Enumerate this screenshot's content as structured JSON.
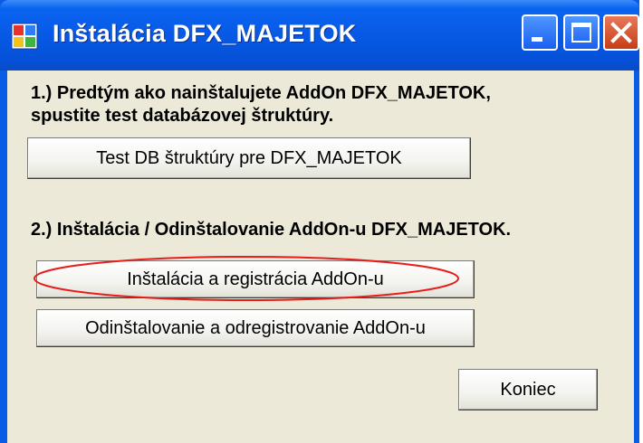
{
  "window": {
    "title": "Inštalácia DFX_MAJETOK",
    "controls": {
      "minimize": "minimize-icon",
      "maximize": "maximize-icon",
      "close": "close-icon"
    }
  },
  "section1": {
    "line1": "1.) Predtým ako nainštalujete AddOn DFX_MAJETOK,",
    "line2": "spustite test databázovej štruktúry.",
    "test_button": "Test DB  štruktúry pre DFX_MAJETOK"
  },
  "section2": {
    "heading": "2.) Inštalácia / Odinštalovanie AddOn-u DFX_MAJETOK.",
    "install_button": "Inštalácia a registrácia AddOn-u",
    "uninstall_button": "Odinštalovanie a odregistrovanie AddOn-u"
  },
  "footer": {
    "close_button": "Koniec"
  },
  "colors": {
    "titlebar": "#0758e4",
    "dialog_bg": "#ece9d8",
    "highlight_ellipse": "#e81c1c",
    "close_button": "#c73d16"
  }
}
